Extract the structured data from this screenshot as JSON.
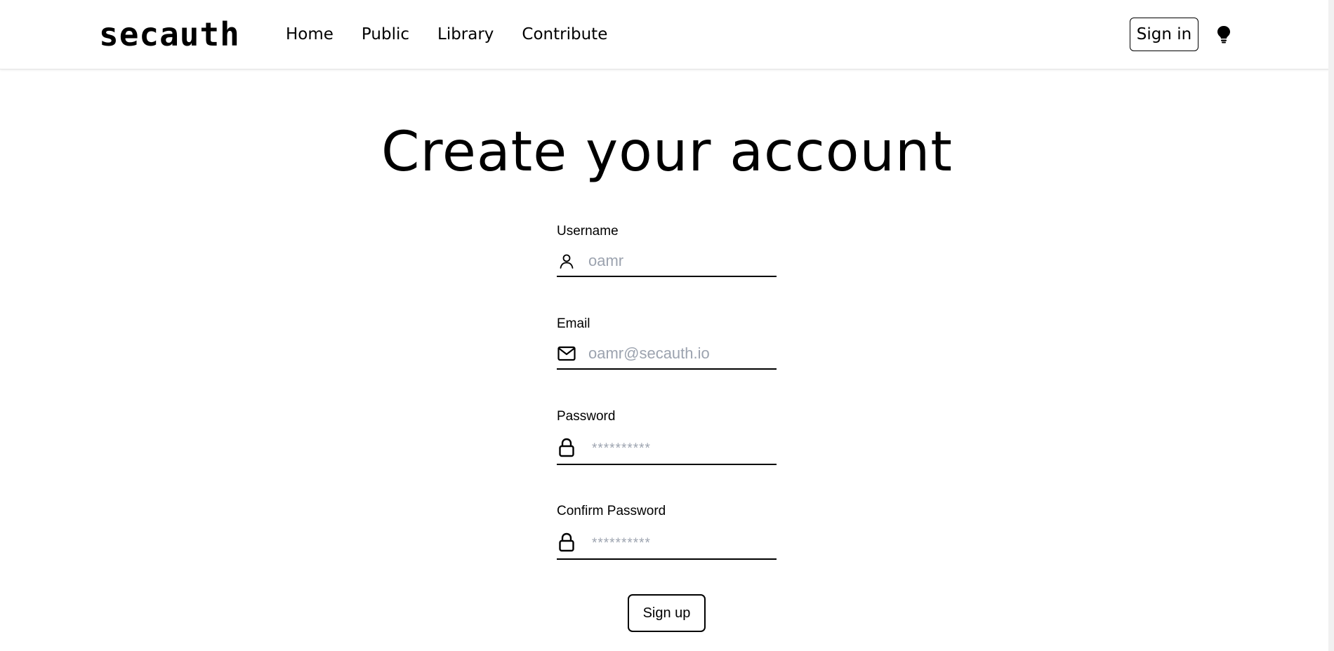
{
  "header": {
    "logo": "secauth",
    "nav": [
      {
        "label": "Home"
      },
      {
        "label": "Public"
      },
      {
        "label": "Library"
      },
      {
        "label": "Contribute"
      }
    ],
    "signin_label": "Sign in",
    "theme_icon": "lightbulb-icon"
  },
  "main": {
    "title": "Create your account",
    "fields": {
      "username": {
        "label": "Username",
        "placeholder": "oamr",
        "icon": "user-icon"
      },
      "email": {
        "label": "Email",
        "placeholder": "oamr@secauth.io",
        "icon": "mail-icon"
      },
      "password": {
        "label": "Password",
        "placeholder": "**********",
        "icon": "lock-icon"
      },
      "confirm_password": {
        "label": "Confirm Password",
        "placeholder": "**********",
        "icon": "lock-icon"
      }
    },
    "submit_label": "Sign up"
  }
}
